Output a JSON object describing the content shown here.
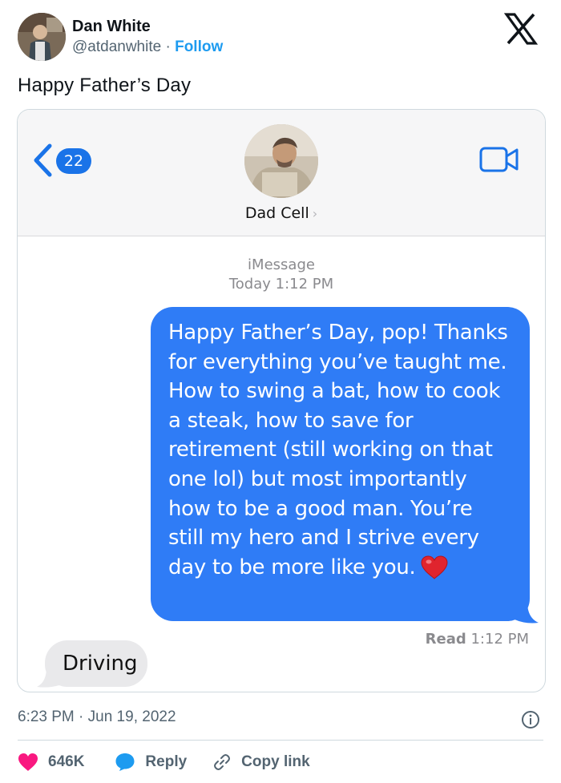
{
  "author": {
    "display_name": "Dan White",
    "handle": "@atdanwhite",
    "separator": "·",
    "follow_label": "Follow"
  },
  "tweet_text": "Happy Father’s Day",
  "imessage": {
    "unread_count": "22",
    "contact_name": "Dad Cell",
    "contact_chevron": "›",
    "service_label": "iMessage",
    "service_time": "Today 1:12 PM",
    "outgoing_message": "Happy Father’s Day, pop! Thanks for everything you’ve taught me. How to swing a bat, how to cook a steak, how to save for retirement (still working on that one lol) but most importantly how to be a good man. You’re still my hero and I strive every day to be more like you.",
    "read_label": "Read",
    "read_time": "1:12 PM",
    "incoming_message": "Driving",
    "bubble_color": "#2f7cf6"
  },
  "footer": {
    "timestamp": "6:23 PM · Jun 19, 2022",
    "like_count": "646K",
    "reply_label": "Reply",
    "copy_link_label": "Copy link"
  },
  "icons": {
    "brand": "x-logo-icon",
    "back": "chevron-left-icon",
    "video": "video-camera-icon",
    "emoji": "red-heart-icon",
    "info": "info-icon",
    "like": "heart-icon",
    "reply": "speech-bubble-icon",
    "link": "link-icon"
  },
  "colors": {
    "accent": "#1d9bf0",
    "like": "#f91880",
    "imessage_blue": "#2f7cf6"
  }
}
